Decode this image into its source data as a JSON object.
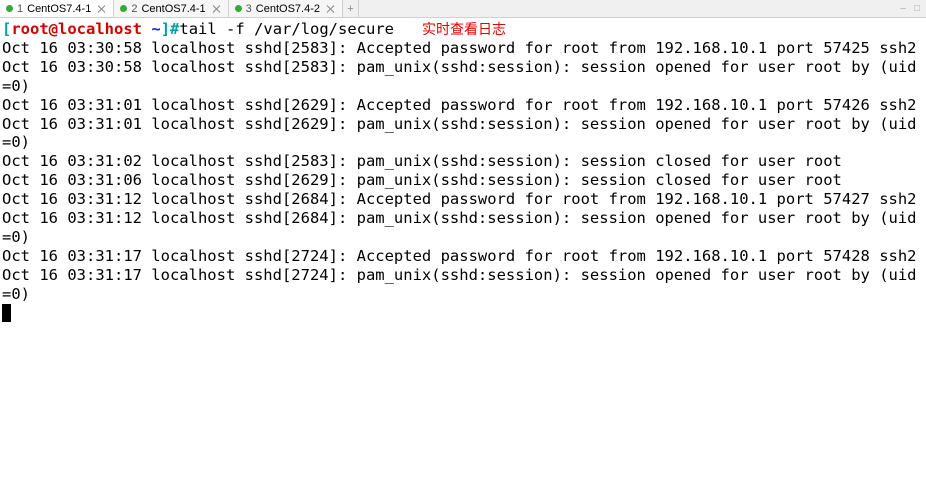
{
  "tabs": [
    {
      "num": "1",
      "label": "CentOS7.4-1",
      "active": true
    },
    {
      "num": "2",
      "label": "CentOS7.4-1",
      "active": false
    },
    {
      "num": "3",
      "label": "CentOS7.4-2",
      "active": false
    }
  ],
  "addtab": "+",
  "winbtns": {
    "min": "–",
    "max": "□"
  },
  "prompt": {
    "open": "[",
    "user": "root",
    "at": "@",
    "host": "localhost",
    "sep": " ",
    "path": "~",
    "close": "]#"
  },
  "command": "tail -f /var/log/secure",
  "annotation": "实时查看日志",
  "log_lines": [
    "Oct 16 03:30:58 localhost sshd[2583]: Accepted password for root from 192.168.10.1 port 57425 ssh2",
    "Oct 16 03:30:58 localhost sshd[2583]: pam_unix(sshd:session): session opened for user root by (uid=0)",
    "Oct 16 03:31:01 localhost sshd[2629]: Accepted password for root from 192.168.10.1 port 57426 ssh2",
    "Oct 16 03:31:01 localhost sshd[2629]: pam_unix(sshd:session): session opened for user root by (uid=0)",
    "Oct 16 03:31:02 localhost sshd[2583]: pam_unix(sshd:session): session closed for user root",
    "Oct 16 03:31:06 localhost sshd[2629]: pam_unix(sshd:session): session closed for user root",
    "Oct 16 03:31:12 localhost sshd[2684]: Accepted password for root from 192.168.10.1 port 57427 ssh2",
    "Oct 16 03:31:12 localhost sshd[2684]: pam_unix(sshd:session): session opened for user root by (uid=0)",
    "Oct 16 03:31:17 localhost sshd[2724]: Accepted password for root from 192.168.10.1 port 57428 ssh2",
    "Oct 16 03:31:17 localhost sshd[2724]: pam_unix(sshd:session): session opened for user root by (uid=0)"
  ]
}
